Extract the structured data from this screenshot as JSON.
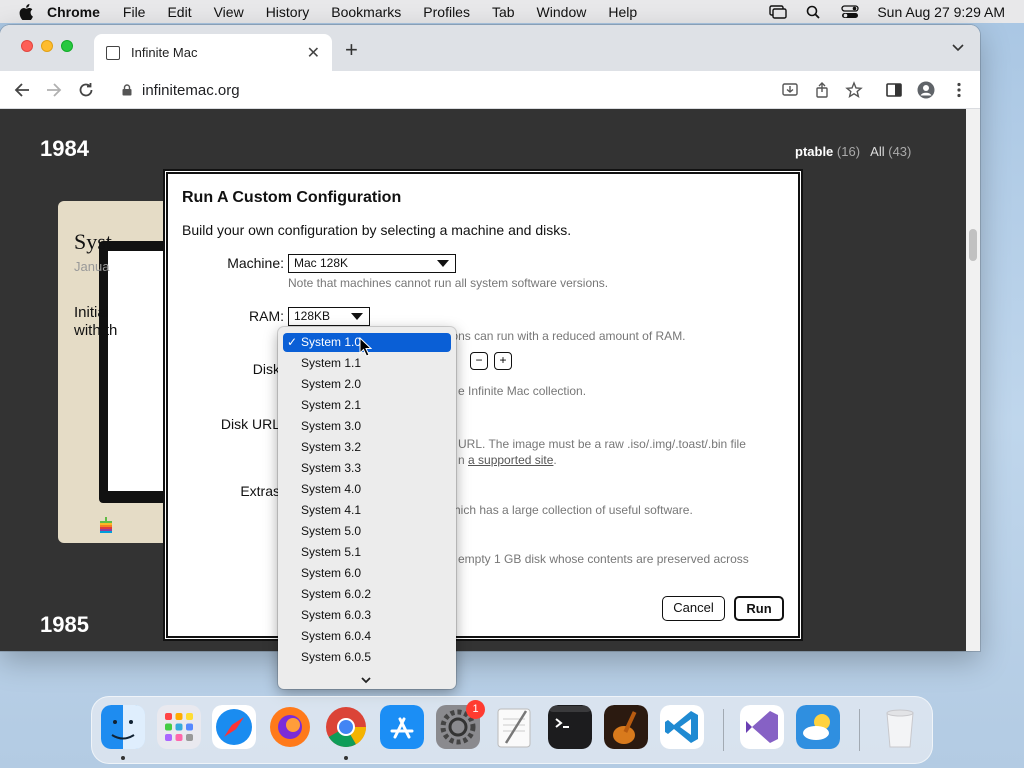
{
  "menubar": {
    "app_name": "Chrome",
    "items": [
      "File",
      "Edit",
      "View",
      "History",
      "Bookmarks",
      "Profiles",
      "Tab",
      "Window",
      "Help"
    ],
    "datetime": "Sun Aug 27  9:29 AM",
    "icons": [
      "apple-icon",
      "screen-mirroring-icon",
      "spotlight-search-icon",
      "control-center-icon"
    ]
  },
  "browser": {
    "tab_title": "Infinite Mac",
    "url": "infinitemac.org",
    "colors": {
      "tabstrip": "#dee1e6",
      "toolbar": "#ffffff"
    }
  },
  "page": {
    "year_1984": "1984",
    "year_1985": "1985",
    "filter_label": "ptable",
    "filter_count": "(16)",
    "all_label": "All",
    "all_count": "(43)",
    "card": {
      "title": "Syst",
      "date": "Janua",
      "description_line1": "Initial",
      "description_line2": "with th"
    }
  },
  "dialog": {
    "title": "Run A Custom Configuration",
    "subtitle": "Build your own configuration by selecting a machine and disks.",
    "machine_label": "Machine:",
    "machine_value": "Mac 128K",
    "machine_help": "Note that machines cannot run all system software versions.",
    "ram_label": "RAM:",
    "ram_value": "128KB",
    "ram_help": "Not all operating systems versions can run with a reduced amount of RAM.",
    "disk_label": "Disk",
    "disk_help": "e Infinite Mac collection.",
    "remove_disk": "−",
    "add_disk": "+",
    "disk_url_label": "Disk URL",
    "disk_url_help_1": "URL. The image must be a raw .iso/.img/.toast/.bin file",
    "disk_url_help_2_prefix": "n",
    "disk_url_help_2_link": "a supported site",
    "disk_url_help_2_suffix": ".",
    "extras_label": "Extras",
    "extras_help_1": "hich has a large collection of useful software.",
    "extras_help_2": "empty 1 GB disk whose contents are preserved across",
    "cancel_label": "Cancel",
    "run_label": "Run"
  },
  "disk_dropdown": {
    "selected": "System 1.0",
    "check_mark": "✓",
    "options": [
      "System 1.0",
      "System 1.1",
      "System 2.0",
      "System 2.1",
      "System 3.0",
      "System 3.2",
      "System 3.3",
      "System 4.0",
      "System 4.1",
      "System 5.0",
      "System 5.1",
      "System 6.0",
      "System 6.0.2",
      "System 6.0.3",
      "System 6.0.4",
      "System 6.0.5"
    ],
    "colors": {
      "highlight": "#0a5fd6"
    }
  },
  "dock": {
    "apps": [
      "finder-icon",
      "launchpad-icon",
      "safari-icon",
      "firefox-icon",
      "chrome-icon",
      "app-store-icon",
      "system-settings-icon",
      "textedit-icon",
      "terminal-icon",
      "garageband-icon",
      "vscode-icon",
      "visual-studio-icon",
      "weather-icon",
      "trash-icon"
    ],
    "settings_badge": "1"
  }
}
